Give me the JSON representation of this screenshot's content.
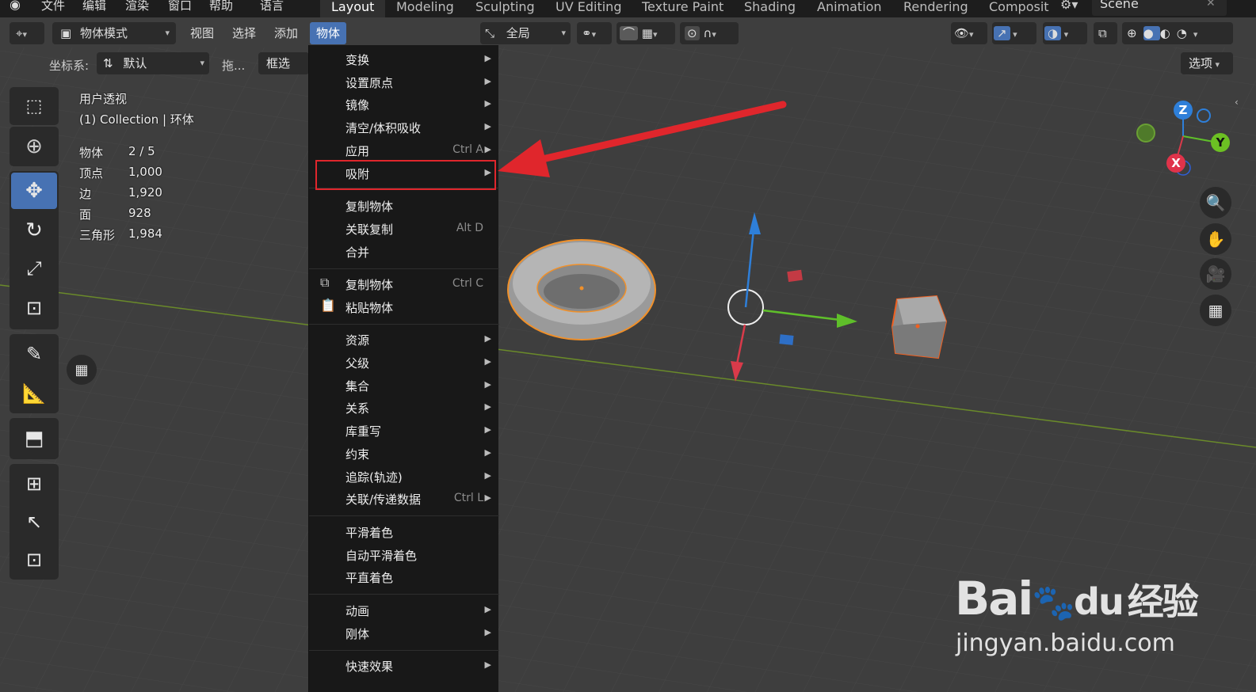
{
  "topbar": {
    "menus": [
      "文件",
      "编辑",
      "渲染",
      "窗口",
      "帮助",
      "语言"
    ],
    "workspaces": [
      "Layout",
      "Modeling",
      "Sculpting",
      "UV Editing",
      "Texture Paint",
      "Shading",
      "Animation",
      "Rendering",
      "Composit"
    ],
    "scene": "Scene"
  },
  "header": {
    "mode": "物体模式",
    "menus": [
      "视图",
      "选择",
      "添加",
      "物体"
    ],
    "transform_orientation": "全局",
    "coord_label": "坐标系:",
    "coord_value": "默认",
    "drag_label": "拖...",
    "select_box": "框选",
    "options": "选项"
  },
  "overlay_stats": {
    "view": "用户透视",
    "collection": "(1) Collection | 环体",
    "rows": [
      {
        "k": "物体",
        "v": "2 / 5"
      },
      {
        "k": "顶点",
        "v": "1,000"
      },
      {
        "k": "边",
        "v": "1,920"
      },
      {
        "k": "面",
        "v": "928"
      },
      {
        "k": "三角形",
        "v": "1,984"
      }
    ]
  },
  "object_menu": {
    "items": [
      {
        "label": "变换",
        "submenu": true
      },
      {
        "label": "设置原点",
        "submenu": true
      },
      {
        "label": "镜像",
        "submenu": true
      },
      {
        "label": "清空/体积吸收",
        "submenu": true
      },
      {
        "label": "应用",
        "shortcut": "Ctrl A",
        "submenu": true
      },
      {
        "label": "吸附",
        "submenu": true,
        "highlighted": true
      },
      {
        "label": "复制物体"
      },
      {
        "label": "关联复制",
        "shortcut": "Alt D"
      },
      {
        "label": "合并"
      },
      {
        "label": "复制物体",
        "shortcut": "Ctrl C"
      },
      {
        "label": "粘贴物体"
      },
      {
        "label": "资源",
        "submenu": true
      },
      {
        "label": "父级",
        "submenu": true
      },
      {
        "label": "集合",
        "submenu": true
      },
      {
        "label": "关系",
        "submenu": true
      },
      {
        "label": "库重写",
        "submenu": true
      },
      {
        "label": "约束",
        "submenu": true
      },
      {
        "label": "追踪(轨迹)",
        "submenu": true
      },
      {
        "label": "关联/传递数据",
        "shortcut": "Ctrl L",
        "submenu": true
      },
      {
        "label": "平滑着色"
      },
      {
        "label": "自动平滑着色"
      },
      {
        "label": "平直着色"
      },
      {
        "label": "动画",
        "submenu": true
      },
      {
        "label": "刚体",
        "submenu": true
      },
      {
        "label": "快速效果",
        "submenu": true
      }
    ]
  },
  "gizmo": {
    "z": "Z",
    "y": "Y",
    "x": "X"
  },
  "watermark": {
    "brand": "Bai",
    "brand2": "du",
    "cn": "经验",
    "url": "jingyan.baidu.com"
  },
  "colors": {
    "accent": "#4772b3",
    "highlight_box": "#e0262c",
    "arrow": "#e0262c",
    "selection": "#f0902a"
  }
}
